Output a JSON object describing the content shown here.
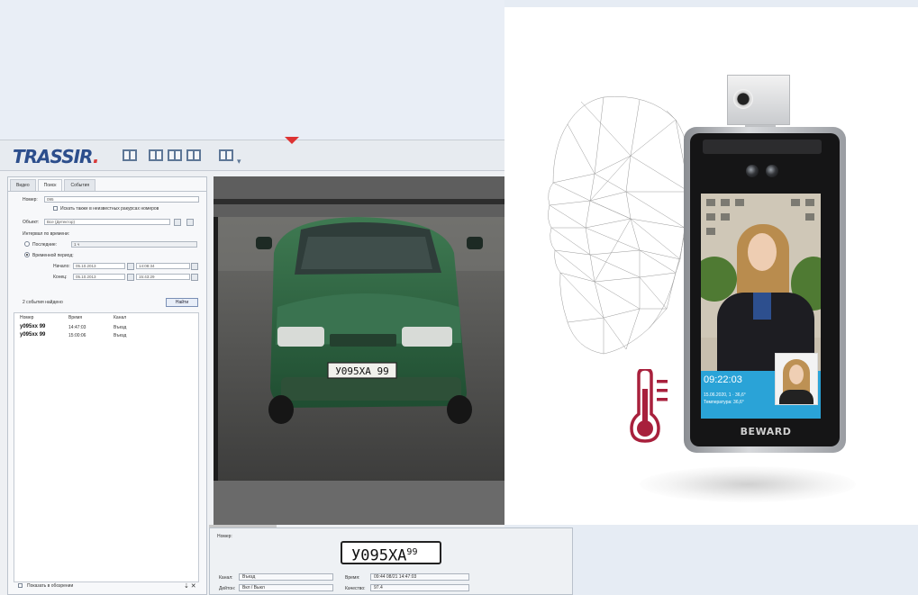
{
  "trassir": {
    "logo": "TRASSIR",
    "tabs": [
      {
        "label": "Видео"
      },
      {
        "label": "Поиск"
      },
      {
        "label": "События"
      }
    ],
    "form": {
      "plate_label": "Номер:",
      "plate_value": "095",
      "checkbox_label": "Искать также в неизвестных ракурсах номеров",
      "object_label": "Объект:",
      "object_value": "Все (Детектор)",
      "time_interval_label": "Интервал по времени:",
      "radio_last_label": "Последние:",
      "radio_last_value": "1 ч",
      "radio_range_label": "Временной период:",
      "start_label": "Начало:",
      "start_date": "05.10.2013",
      "start_time": "14:08:34",
      "end_label": "Конец:",
      "end_date": "05.10.2013",
      "end_time": "15:43:29",
      "events_label": "2 события найдено",
      "find_button": "Найти"
    },
    "results": {
      "headers": [
        "Номер",
        "Время",
        "Канал"
      ],
      "rows": [
        {
          "plate": "у095хх 99",
          "time": "14:47:03",
          "channel": "Въезд"
        },
        {
          "plate": "у095хх 99",
          "time": "15:00:06",
          "channel": "Въезд"
        }
      ]
    },
    "status_bar": "Показать в обозрении",
    "video_plate_text": "У095ХА 99",
    "plate_panel": {
      "label": "Номер:",
      "plate_main": "У095ХА",
      "plate_region": "99",
      "fields": [
        {
          "label": "Канал:",
          "value": "Въезд"
        },
        {
          "label": "Время:",
          "value": "09:44 08/21 14:47:03"
        },
        {
          "label": "Дейтон:",
          "value": "Вкл / Выкл"
        },
        {
          "label": "Качество:",
          "value": "97.4"
        }
      ]
    }
  },
  "device": {
    "screen_time": "09:22:03",
    "screen_line1": "15.06.2020, 1 · 36,6°",
    "screen_line2": "Температура: 36,6°",
    "brand": "BEWARD"
  },
  "colors": {
    "trassir_blue": "#2c4e8c",
    "screen_info_blue": "#2aa3d7",
    "thermometer_red": "#a8203c"
  }
}
